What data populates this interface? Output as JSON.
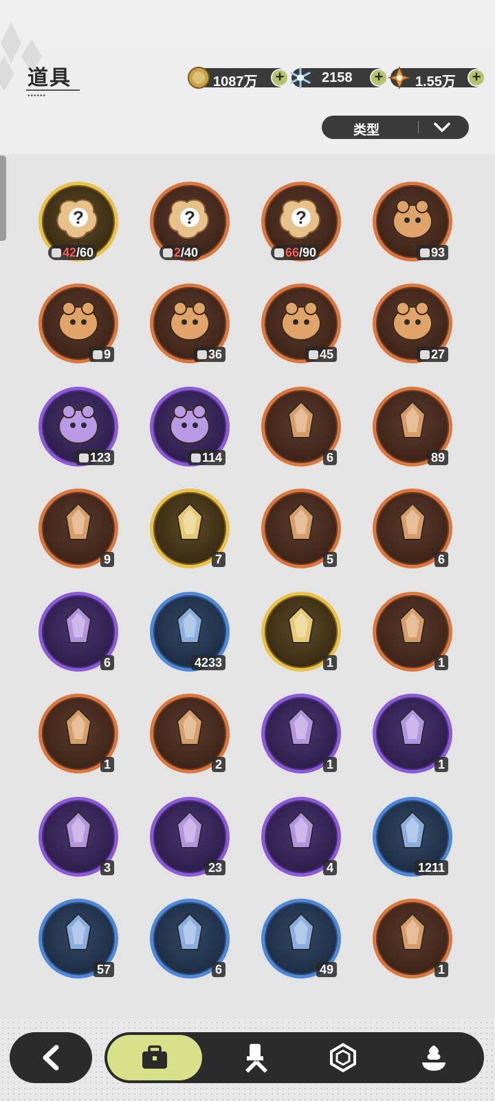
{
  "header": {
    "title": "道具",
    "currencies": [
      {
        "icon": "gold-coin-icon",
        "value": "1087万"
      },
      {
        "icon": "crystal-snowflake-icon",
        "value": "2158"
      },
      {
        "icon": "star-shard-icon",
        "value": "1.55万"
      }
    ],
    "plus_label": "+"
  },
  "filter": {
    "label": "类型"
  },
  "items": [
    {
      "name": "unknown-fragment-gold",
      "rarity": "gold",
      "badge_current": "42",
      "badge_total": "/60",
      "fragment": true
    },
    {
      "name": "unknown-fragment-orange",
      "rarity": "orange",
      "badge_current": "2",
      "badge_total": "/40",
      "fragment": true
    },
    {
      "name": "unknown-fragment-orange-2",
      "rarity": "orange",
      "badge_current": "66",
      "badge_total": "/90",
      "fragment": true
    },
    {
      "name": "bear-fragment",
      "rarity": "orange",
      "count": "93",
      "piece": true
    },
    {
      "name": "knight-fragment",
      "rarity": "orange",
      "count": "9",
      "piece": true
    },
    {
      "name": "white-creature-fragment",
      "rarity": "orange",
      "count": "36",
      "piece": true
    },
    {
      "name": "dark-creature-fragment",
      "rarity": "orange",
      "count": "45",
      "piece": true
    },
    {
      "name": "purple-creature-fragment",
      "rarity": "orange",
      "count": "27",
      "piece": true
    },
    {
      "name": "green-creature-fragment",
      "rarity": "purple",
      "count": "123",
      "piece": true
    },
    {
      "name": "yellow-creature-fragment",
      "rarity": "purple",
      "count": "114",
      "piece": true
    },
    {
      "name": "purple-crystal",
      "rarity": "orange",
      "count": "6"
    },
    {
      "name": "blue-crystal",
      "rarity": "orange",
      "count": "89"
    },
    {
      "name": "paw-charm",
      "rarity": "orange",
      "count": "9"
    },
    {
      "name": "gold-card",
      "rarity": "gold",
      "count": "7"
    },
    {
      "name": "rainbow-card",
      "rarity": "orange",
      "count": "5"
    },
    {
      "name": "orange-card",
      "rarity": "orange",
      "count": "6"
    },
    {
      "name": "purple-card",
      "rarity": "purple",
      "count": "6"
    },
    {
      "name": "blue-card",
      "rarity": "blue",
      "count": "4233"
    },
    {
      "name": "golden-feather",
      "rarity": "gold",
      "count": "1"
    },
    {
      "name": "butterfly-hairpin",
      "rarity": "orange",
      "count": "1"
    },
    {
      "name": "crystal-ring",
      "rarity": "orange",
      "count": "1"
    },
    {
      "name": "silver-card",
      "rarity": "orange",
      "count": "2"
    },
    {
      "name": "golden-horns",
      "rarity": "purple",
      "count": "1"
    },
    {
      "name": "gift-box",
      "rarity": "purple",
      "count": "1"
    },
    {
      "name": "magic-mirror",
      "rarity": "purple",
      "count": "3"
    },
    {
      "name": "scroll",
      "rarity": "purple",
      "count": "23"
    },
    {
      "name": "pink-apple",
      "rarity": "purple",
      "count": "4"
    },
    {
      "name": "shovel",
      "rarity": "blue",
      "count": "1211"
    },
    {
      "name": "iron-gauntlet",
      "rarity": "blue",
      "count": "57"
    },
    {
      "name": "pickaxe",
      "rarity": "blue",
      "count": "6"
    },
    {
      "name": "hammer-set",
      "rarity": "blue",
      "count": "49"
    },
    {
      "name": "green-cloud",
      "rarity": "orange",
      "count": "1"
    }
  ],
  "nav": {
    "back_icon": "back-arrow-icon",
    "tabs": [
      {
        "icon": "backpack-icon",
        "active": true
      },
      {
        "icon": "tools-icon",
        "active": false
      },
      {
        "icon": "hexagon-gem-icon",
        "active": false
      },
      {
        "icon": "pudding-icon",
        "active": false
      }
    ]
  },
  "colors": {
    "orange_ring": "#d9773f",
    "gold_ring": "#e8c24a",
    "purple_ring": "#8b5bd6",
    "blue_ring": "#4f88d6",
    "accent": "#d9e08a",
    "plus": "#b5c46a"
  }
}
